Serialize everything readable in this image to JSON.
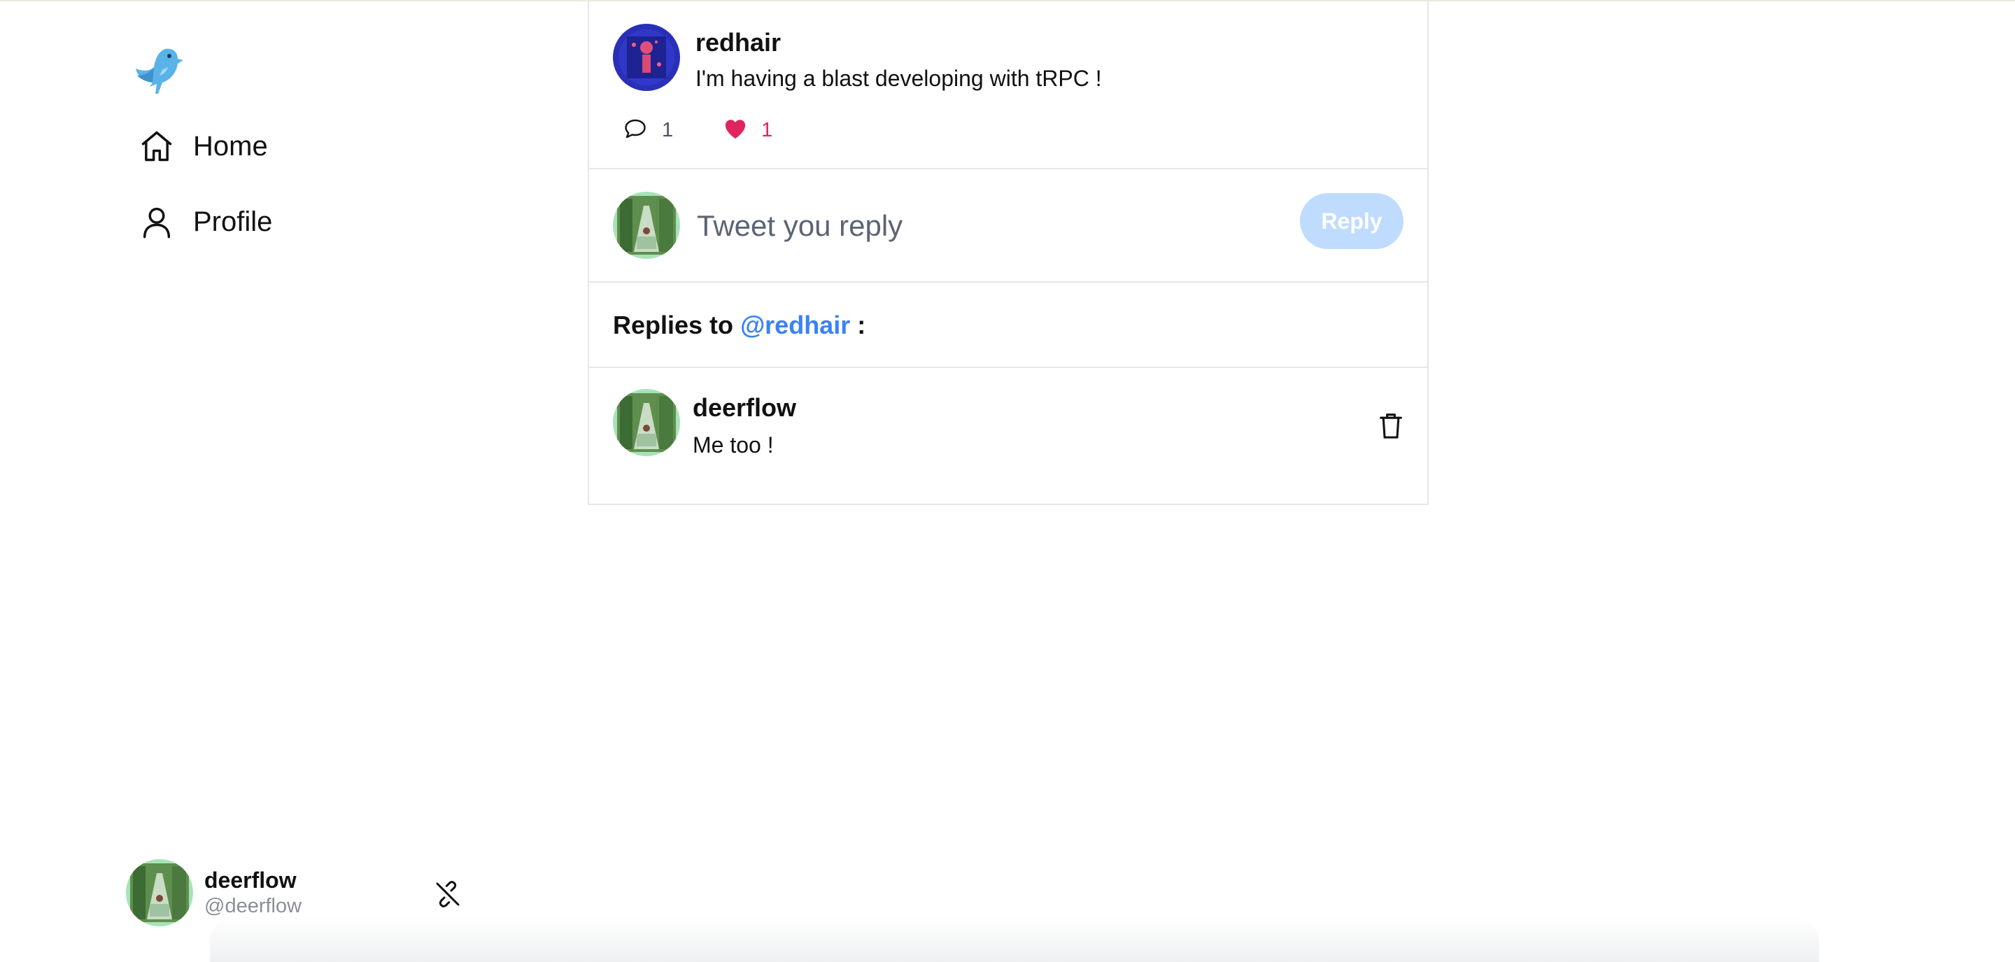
{
  "sidebar": {
    "logo_icon": "bird-logo-icon",
    "nav": [
      {
        "label": "Home",
        "icon": "home-icon"
      },
      {
        "label": "Profile",
        "icon": "user-icon"
      }
    ]
  },
  "account": {
    "name": "deerflow",
    "handle": "@deerflow",
    "logout_icon": "unlink-icon"
  },
  "tweet": {
    "author": "redhair",
    "text": "I'm having a blast developing with tRPC !",
    "comments_count": "1",
    "likes_count": "1",
    "liked": true
  },
  "reply_box": {
    "placeholder": "Tweet you reply",
    "value": "",
    "button_label": "Reply",
    "button_enabled": false
  },
  "replies_header": {
    "prefix": "Replies to",
    "mention": "@redhair",
    "suffix": ":"
  },
  "replies": [
    {
      "author": "deerflow",
      "text": "Me too !",
      "action_icon": "trash-icon"
    }
  ],
  "colors": {
    "accent": "#3b82f6",
    "button_disabled": "#bfdbfe",
    "like": "#e0245e",
    "border": "#e5e7eb",
    "muted": "#8a8f98"
  }
}
